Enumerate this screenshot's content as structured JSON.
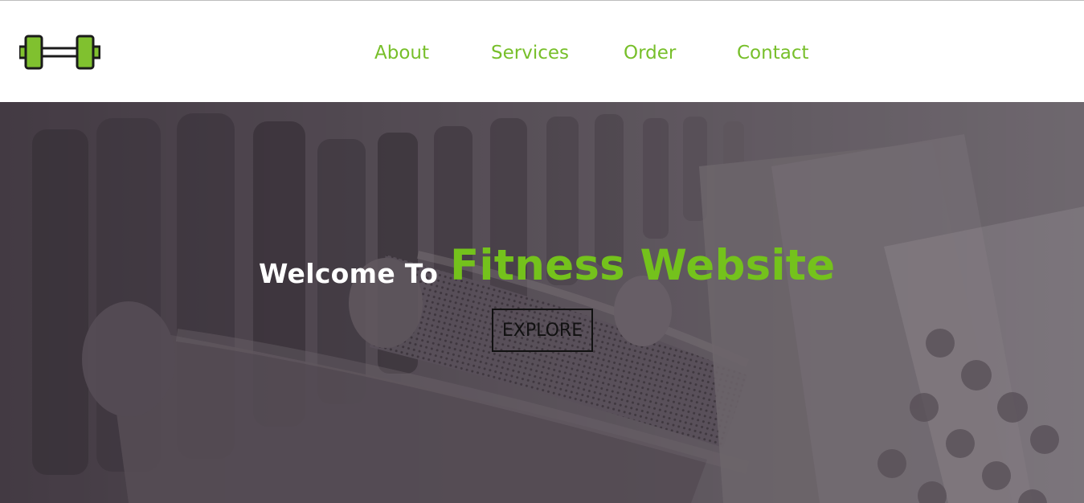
{
  "header": {
    "logo_icon": "dumbbell-icon",
    "nav": {
      "about": "About",
      "services": "Services",
      "order": "Order",
      "contact": "Contact"
    }
  },
  "hero": {
    "welcome": "Welcome To",
    "brand": "Fitness Website",
    "button": "EXPLORE",
    "background": "gym-dumbbells-photo"
  },
  "colors": {
    "accent_green": "#77bf2a",
    "hero_overlay": "#4a4049",
    "white": "#ffffff",
    "dark": "#111111"
  }
}
